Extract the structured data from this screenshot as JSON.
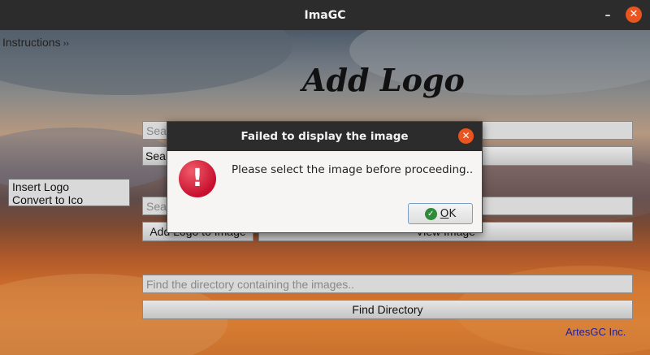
{
  "window": {
    "title": "ImaGC",
    "minimize_glyph": "–",
    "close_glyph": "✕"
  },
  "menu": {
    "instructions_label": "Instructions",
    "chevron": "››"
  },
  "heading": "Add Logo",
  "side_menu": {
    "items": [
      "Insert Logo",
      "Convert to Ico"
    ]
  },
  "form": {
    "search_field_1": "Sear",
    "search_button_1": "Sear",
    "search_field_2": "Sear",
    "add_logo_button": "Add Logo to Image",
    "view_image_button": "View Image",
    "directory_placeholder": "Find the directory containing the images..",
    "find_directory_button": "Find Directory"
  },
  "credit": "ArtesGC Inc.",
  "dialog": {
    "title": "Failed to display the image",
    "message": "Please select the image before proceeding..",
    "error_glyph": "!",
    "ok_underlined": "O",
    "ok_rest": "K",
    "close_glyph": "✕",
    "ok_icon_glyph": "✓"
  },
  "colors": {
    "accent_close": "#e9541f",
    "error_red": "#c8102e",
    "credit_blue": "#2020a0"
  }
}
